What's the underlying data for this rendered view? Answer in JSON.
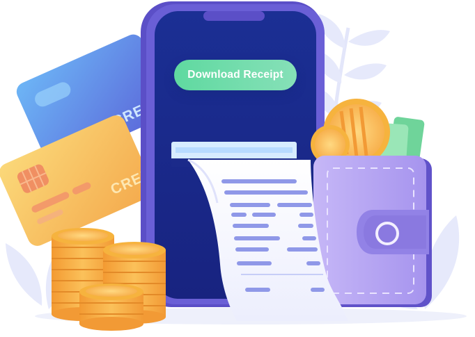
{
  "receipt_illustration": {
    "download_button_label": "Download Receipt",
    "card_label_front": "CREDIT",
    "card_label_back": "CREDIT"
  },
  "colors": {
    "phone_frame": "#5b4fc7",
    "phone_screen": "#1b2a8a",
    "button": "#6ddca9",
    "card_back": "#5a9be8",
    "card_front": "#f6c55c",
    "coin": "#f2a43a",
    "wallet": "#b7a4f2",
    "leaf": "#e6e9fb"
  },
  "icons": [
    "credit-card-icon",
    "chip-icon",
    "coin-stack-icon",
    "wallet-icon",
    "receipt-icon",
    "smartphone-icon"
  ]
}
